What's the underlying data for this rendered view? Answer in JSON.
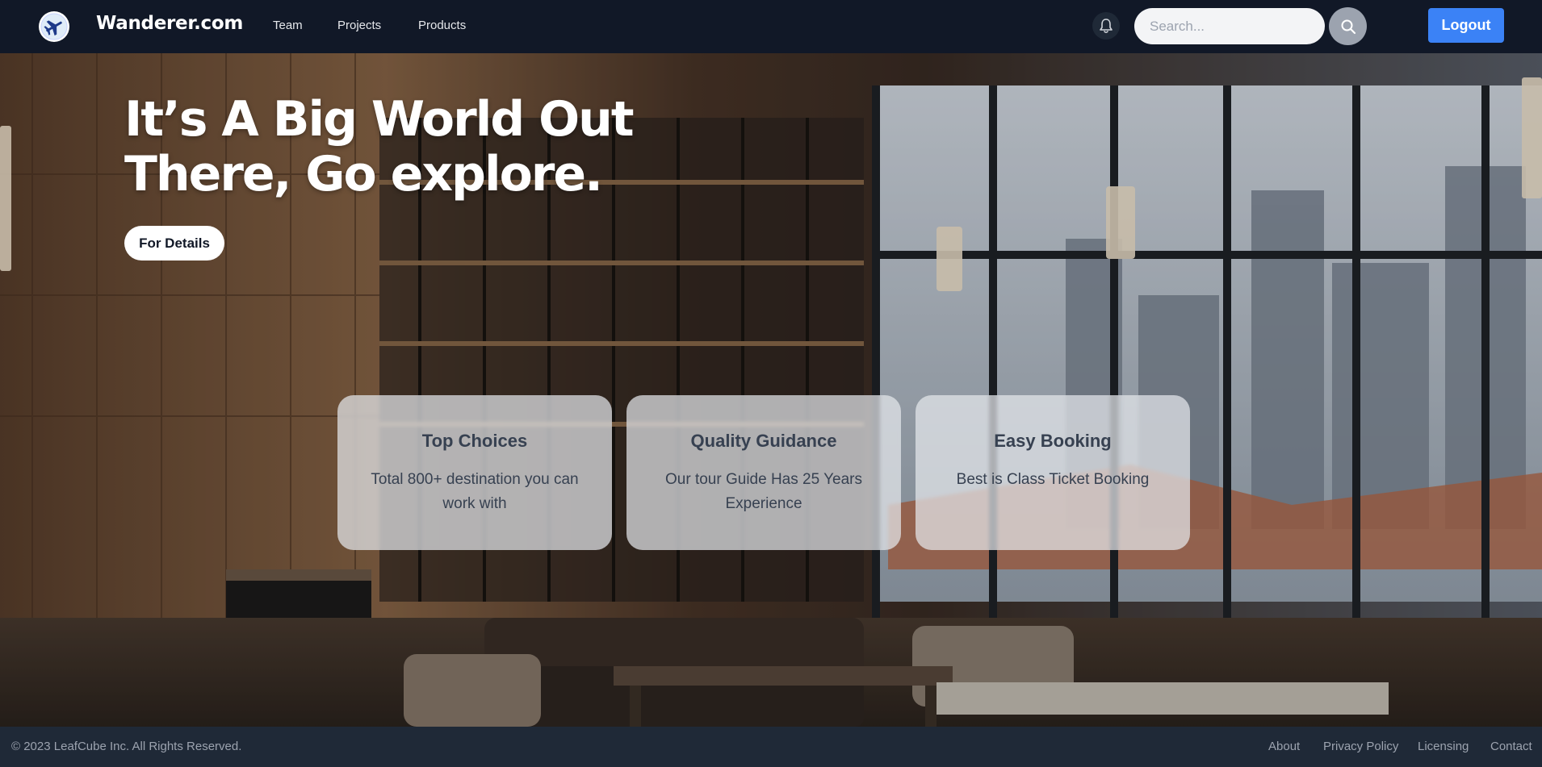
{
  "navbar": {
    "brand": "Wanderer.com",
    "links": [
      "Team",
      "Projects",
      "Products"
    ],
    "search_placeholder": "Search...",
    "logout_label": "Logout"
  },
  "hero": {
    "title_line1": "It’s A Big World Out",
    "title_line2": "There, Go explore.",
    "details_label": "For Details"
  },
  "cards": [
    {
      "title": "Top Choices",
      "text": "Total 800+ destination you can work with"
    },
    {
      "title": "Quality Guidance",
      "text": "Our tour Guide Has 25 Years Experience"
    },
    {
      "title": "Easy Booking",
      "text": "Best is Class Ticket Booking"
    }
  ],
  "footer": {
    "copyright": "© 2023 LeafCube Inc. All Rights Reserved.",
    "links": [
      "About",
      "Privacy Policy",
      "Licensing",
      "Contact"
    ]
  },
  "colors": {
    "navbar_bg": "#111827",
    "footer_bg": "#1f2937",
    "accent": "#3b82f6"
  },
  "icons": {
    "logo": "airplane-icon",
    "notification": "bell-icon",
    "search": "search-icon"
  }
}
